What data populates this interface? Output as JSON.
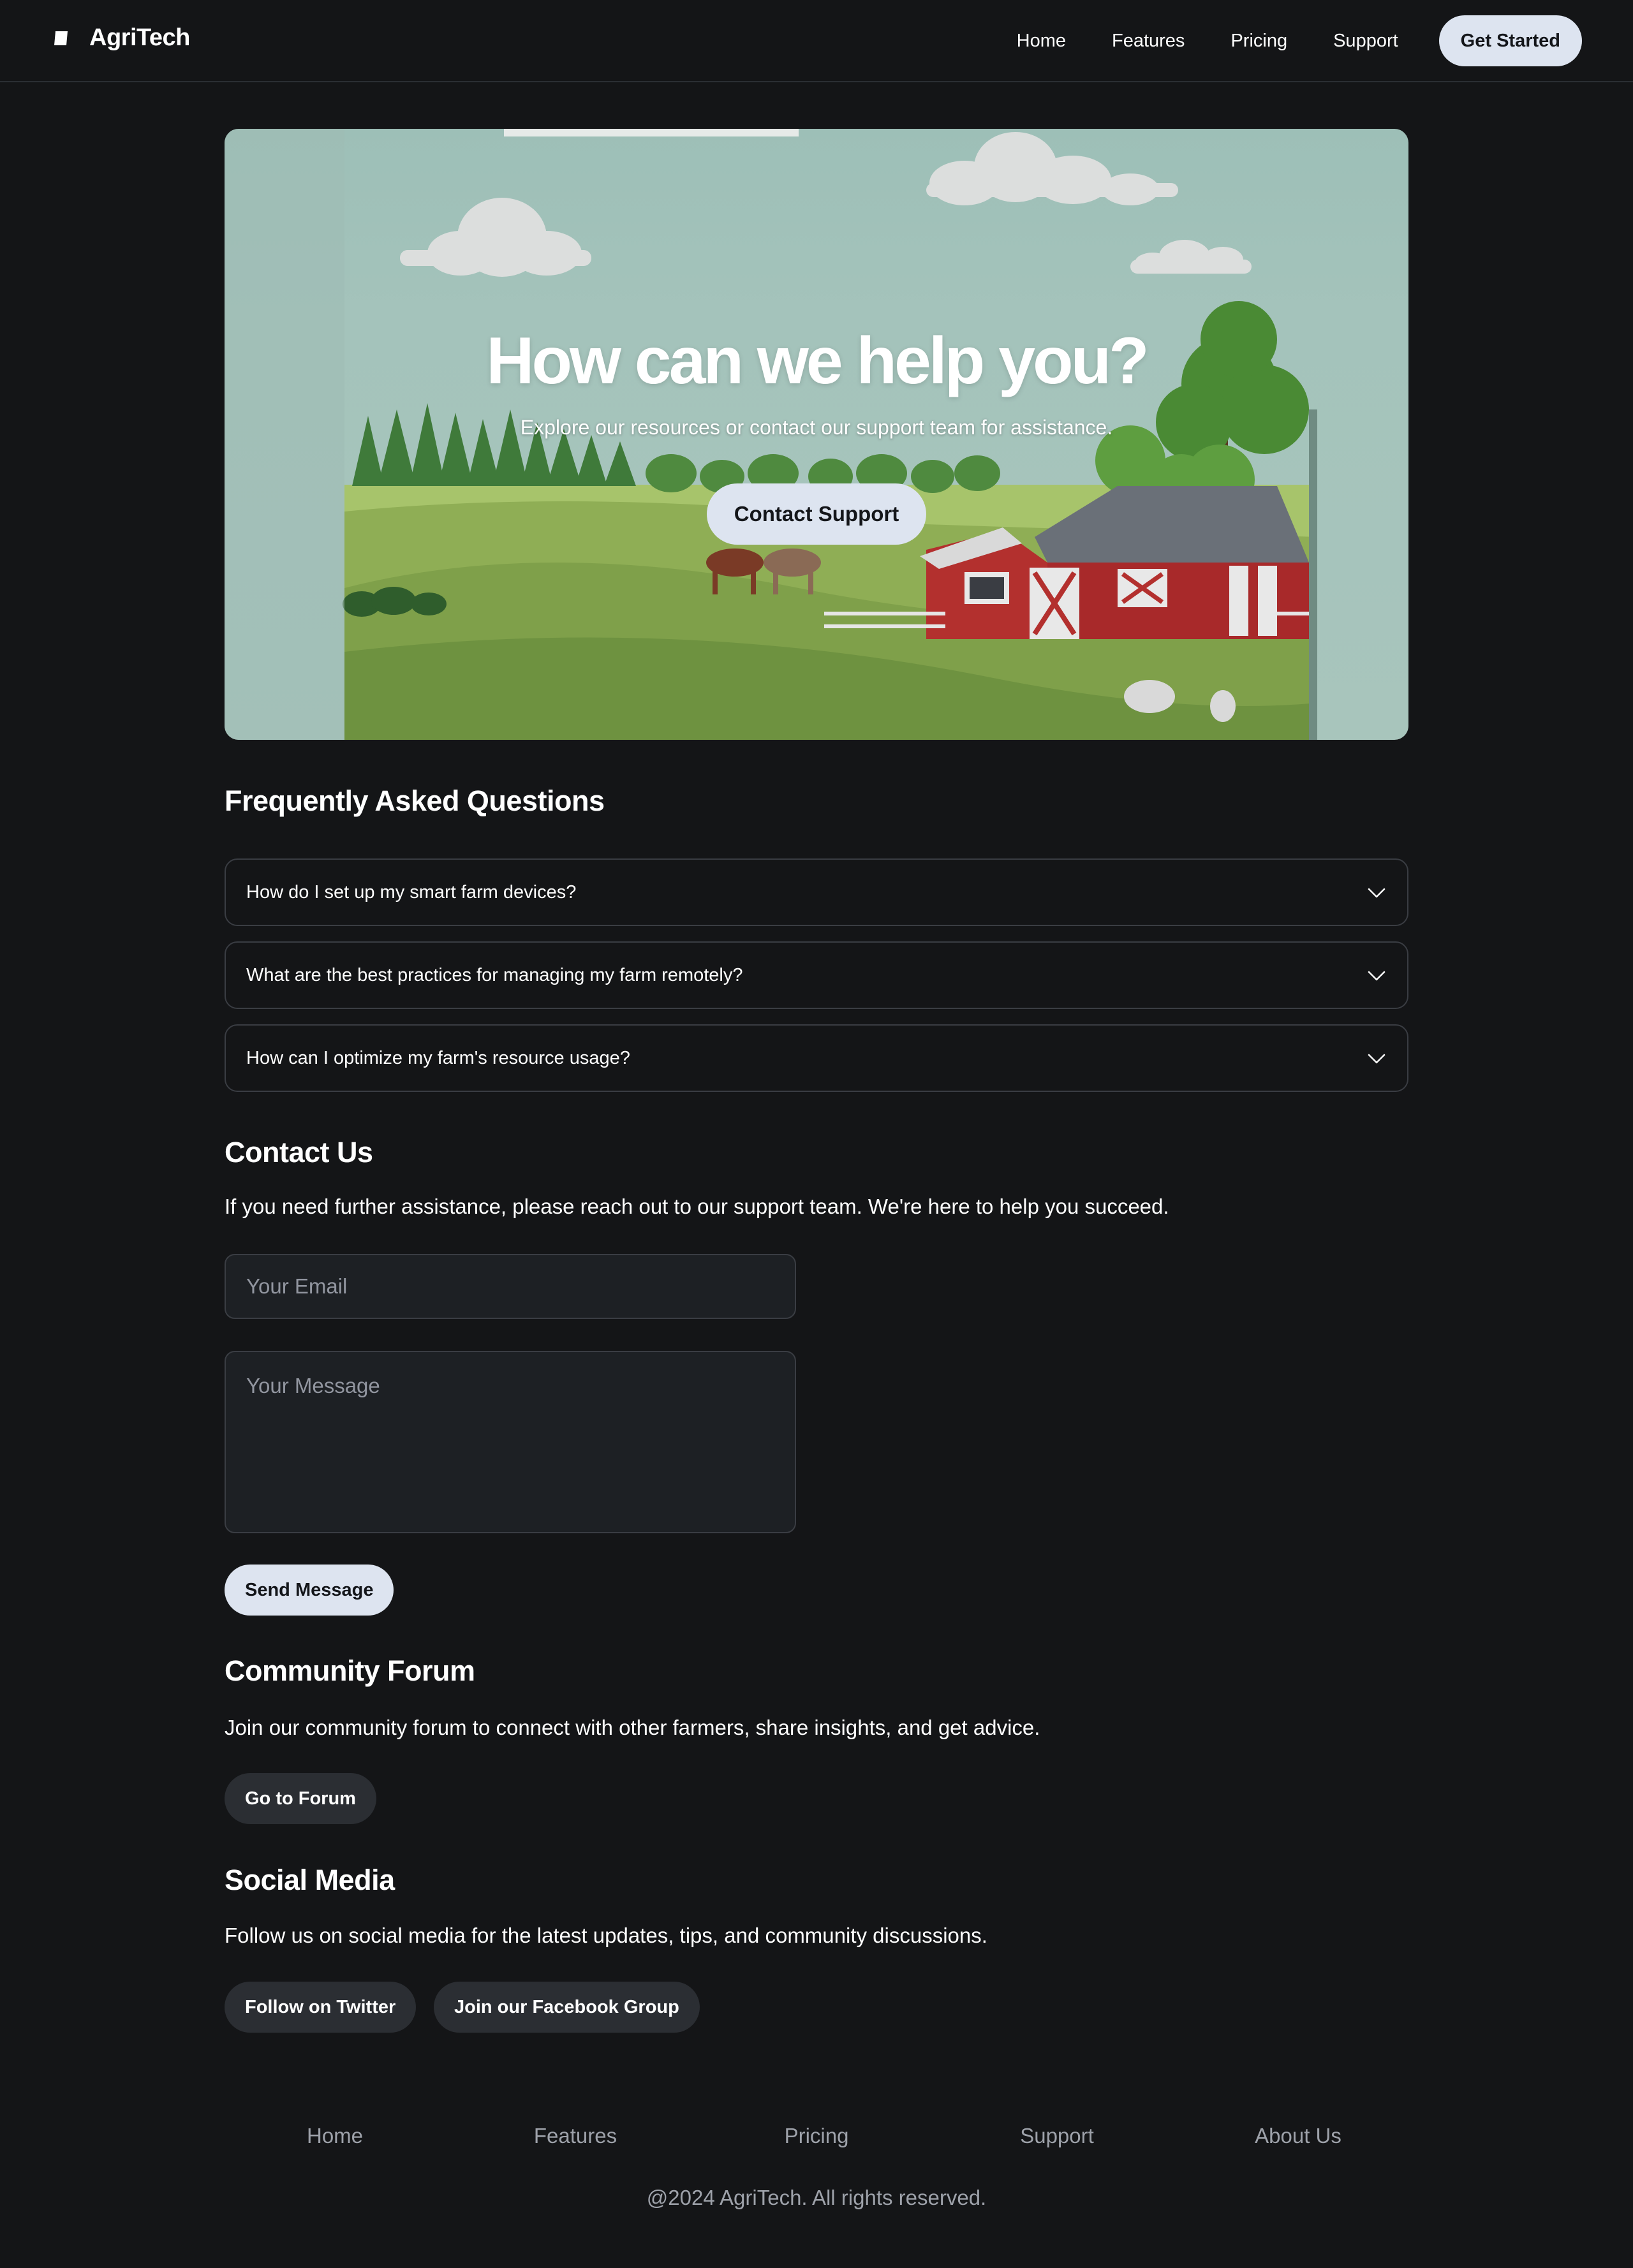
{
  "nav": {
    "brand": "AgriTech",
    "links": [
      "Home",
      "Features",
      "Pricing",
      "Support"
    ],
    "cta": "Get Started"
  },
  "hero": {
    "title": "How can we help you?",
    "subtitle": "Explore our resources or contact our support team for assistance.",
    "button": "Contact Support"
  },
  "faq": {
    "title": "Frequently Asked Questions",
    "items": [
      "How do I set up my smart farm devices?",
      "What are the best practices for managing my farm remotely?",
      "How can I optimize my farm's resource usage?"
    ]
  },
  "contact": {
    "title": "Contact Us",
    "text": "If you need further assistance, please reach out to our support team. We're here to help you succeed.",
    "email_placeholder": "Your Email",
    "message_placeholder": "Your Message",
    "send": "Send Message"
  },
  "forum": {
    "title": "Community Forum",
    "text": "Join our community forum to connect with other farmers, share insights, and get advice.",
    "button": "Go to Forum"
  },
  "social": {
    "title": "Social Media",
    "text": "Follow us on social media for the latest updates, tips, and community discussions.",
    "twitter": "Follow on Twitter",
    "facebook": "Join our Facebook Group"
  },
  "footer": {
    "links": [
      "Home",
      "Features",
      "Pricing",
      "Support",
      "About Us"
    ],
    "copyright": "@2024 AgriTech. All rights reserved."
  },
  "colors": {
    "background": "#141517",
    "button_light": "#dde4f0",
    "button_dark": "#2b2e33",
    "border": "#3a3d43",
    "muted_text": "#9ea2aa",
    "barn_red": "#b3302e",
    "grass": "#7fa04a",
    "sky": "#9dbfb7"
  },
  "icons": {
    "brand": "book-logo-icon",
    "faq_toggle": "chevron-down-icon"
  }
}
